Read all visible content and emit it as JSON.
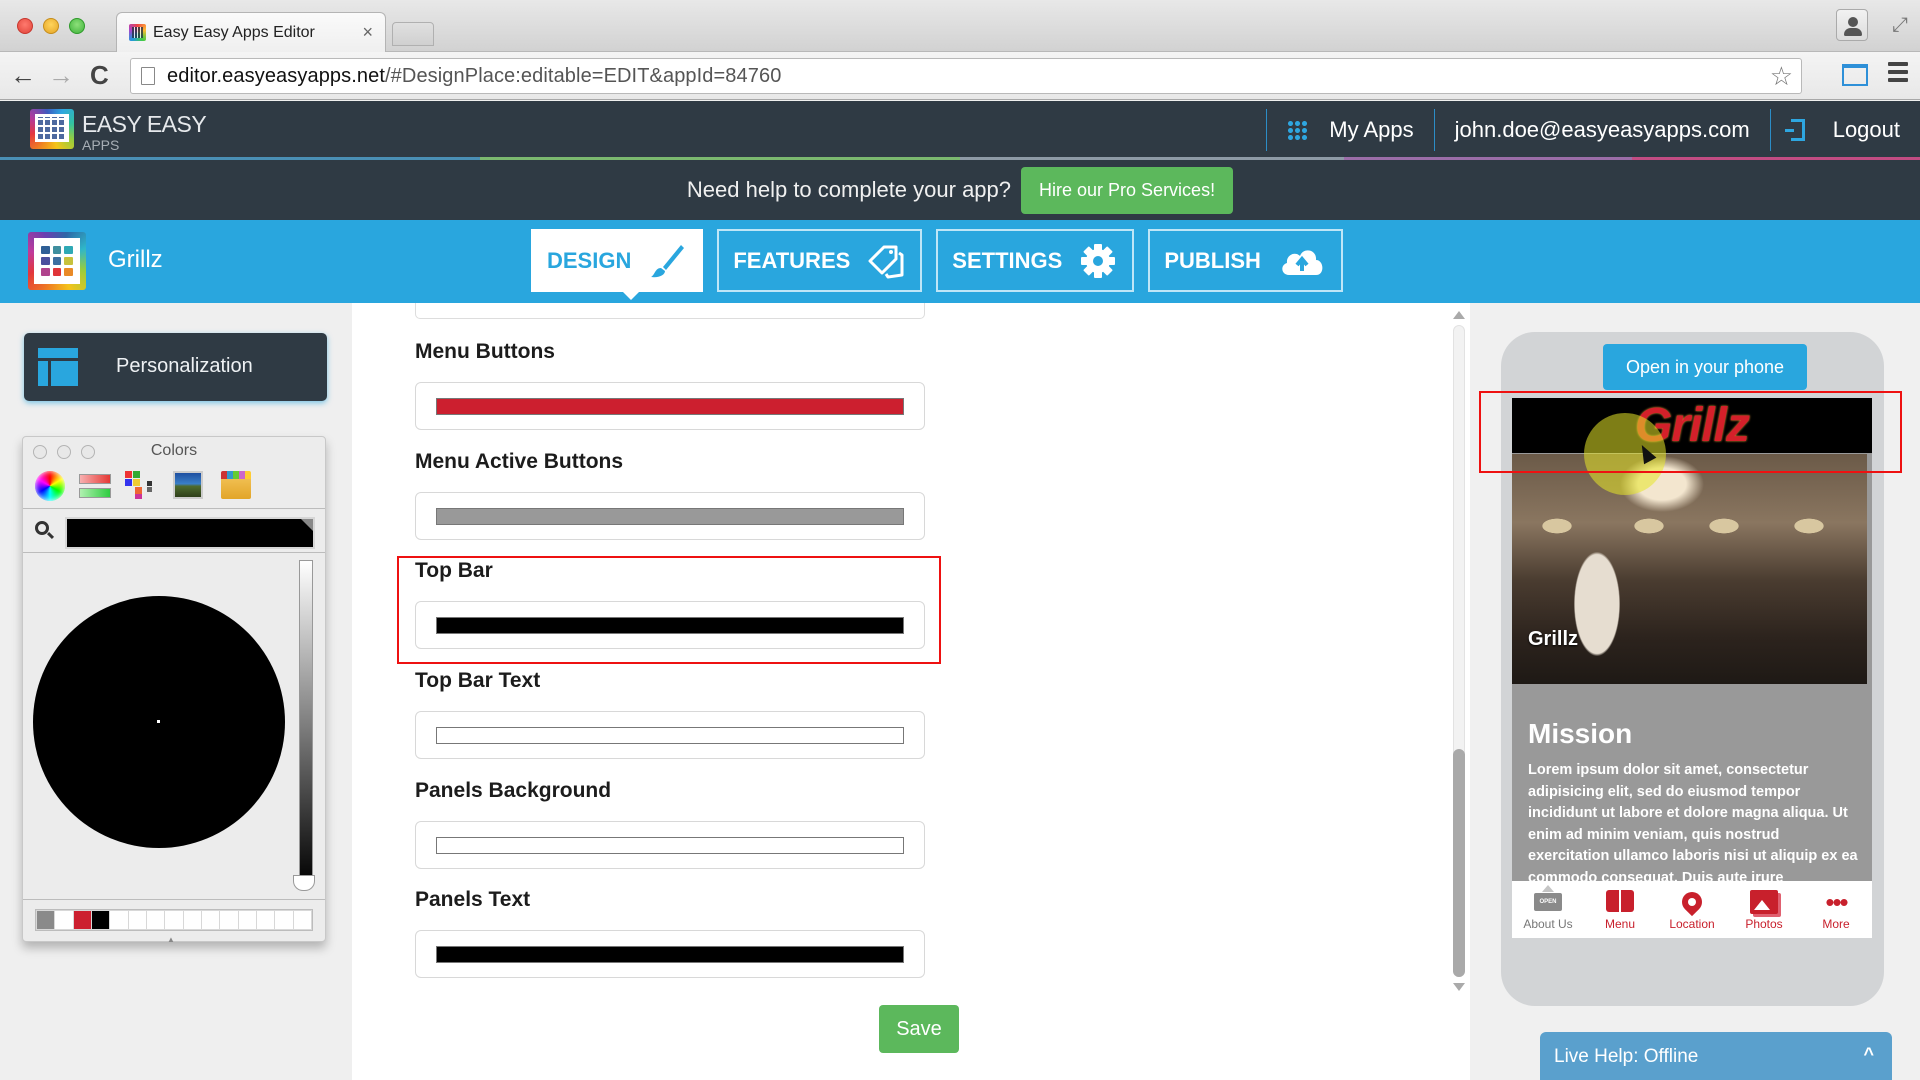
{
  "browser": {
    "tab_title": "Easy Easy Apps Editor",
    "tab_close": "×",
    "url_host": "editor.easyeasyapps.net",
    "url_path": "/#DesignPlace:editable=EDIT&appId=84760",
    "back": "←",
    "forward": "→",
    "reload": "C",
    "bookmark_star": "☆",
    "fullscreen": "⤢"
  },
  "header": {
    "brand_name": "EASY EASY",
    "brand_sub": "APPS",
    "my_apps_label": "My Apps",
    "user_email": "john.doe@easyeasyapps.com",
    "logout_label": "Logout"
  },
  "promo": {
    "text": "Need help to complete your app?",
    "button_label": "Hire our Pro Services!"
  },
  "app": {
    "name": "Grillz",
    "tabs": [
      {
        "label": "DESIGN",
        "icon": "brush-icon",
        "active": true
      },
      {
        "label": "FEATURES",
        "icon": "tags-icon",
        "active": false
      },
      {
        "label": "SETTINGS",
        "icon": "gear-icon",
        "active": false
      },
      {
        "label": "PUBLISH",
        "icon": "cloud-upload-icon",
        "active": false
      }
    ]
  },
  "sidebar": {
    "personalization_label": "Personalization"
  },
  "color_picker": {
    "title": "Colors",
    "current_color": "#000000",
    "swatches": [
      "#8a8a8a",
      "#ffffff",
      "#cc1f2f",
      "#000000",
      "",
      "",
      "",
      "",
      "",
      "",
      "",
      "",
      "",
      "",
      ""
    ]
  },
  "form": {
    "fields": [
      {
        "label": "Menu Buttons",
        "color": "#cc1f2f"
      },
      {
        "label": "Menu Active Buttons",
        "color": "#999999"
      },
      {
        "label": "Top Bar",
        "color": "#000000"
      },
      {
        "label": "Top Bar Text",
        "color": "#ffffff"
      },
      {
        "label": "Panels Background",
        "color": "#ffffff"
      },
      {
        "label": "Panels Text",
        "color": "#000000"
      }
    ],
    "save_label": "Save",
    "highlighted_field": "Top Bar"
  },
  "preview": {
    "open_button": "Open in your phone",
    "topbar_title": "Grillz",
    "hero_caption": "Grillz",
    "mission_title": "Mission",
    "mission_text": "Lorem ipsum dolor sit amet, consectetur adipisicing elit, sed do eiusmod tempor incididunt ut labore et dolore magna aliqua. Ut enim ad minim veniam, quis nostrud exercitation ullamco laboris nisi ut aliquip ex ea commodo consequat. Duis aute irure",
    "tabbar": [
      {
        "label": "About Us",
        "icon": "open-sign-icon",
        "active": false,
        "sign_text": "OPEN"
      },
      {
        "label": "Menu",
        "icon": "book-icon",
        "active": true
      },
      {
        "label": "Location",
        "icon": "location-pin-icon",
        "active": true
      },
      {
        "label": "Photos",
        "icon": "photos-icon",
        "active": true
      },
      {
        "label": "More",
        "icon": "more-dots-icon",
        "active": true,
        "glyph": "•••"
      }
    ]
  },
  "live_help": {
    "label": "Live Help: Offline",
    "chevron": "^"
  },
  "colors": {
    "brand_blue": "#29a6de",
    "header_dark": "#2f3a44",
    "green": "#5cb85c",
    "accent_red": "#cc1f2f"
  }
}
